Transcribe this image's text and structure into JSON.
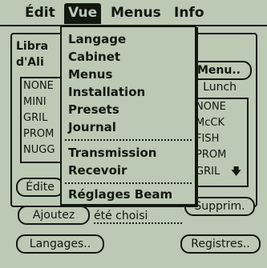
{
  "menubar": {
    "items": [
      "Édit",
      "Vue",
      "Menus",
      "Info"
    ],
    "active": "Vue"
  },
  "background": {
    "left_label_line1": "Libra",
    "left_label_line2": "d'Ali",
    "left_list": [
      "NONE",
      "MINI",
      "GRIL",
      "PROM",
      "NUGG"
    ],
    "menu_button": "Menu..",
    "menu_subtitle": ": Lunch",
    "right_list": [
      "NONE",
      "McCK",
      "FISH",
      "PROM",
      "GRIL"
    ],
    "right_list_scroll_icon": "down-arrow-icon",
    "edit_button": "Édite",
    "add_button": "Ajoutez",
    "status_text": "été choisi",
    "remove_button": "Supprim.",
    "languages_button": "Langages..",
    "registers_button": "Registres.."
  },
  "dropdown": {
    "groups": [
      [
        "Langage",
        "Cabinet",
        "Menus",
        "Installation",
        "Presets",
        "Journal"
      ],
      [
        "Transmission",
        "Recevoir"
      ],
      [
        "Réglages Beam"
      ]
    ]
  },
  "colors": {
    "background": "#bcc9b4",
    "foreground": "#101810"
  }
}
